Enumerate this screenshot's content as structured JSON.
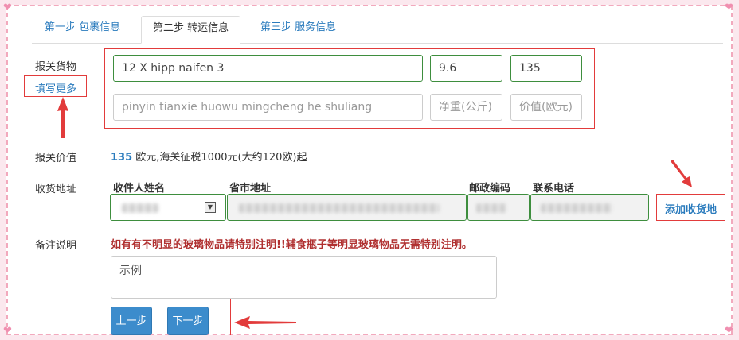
{
  "tabs": [
    {
      "label": "第一步 包裹信息"
    },
    {
      "label": "第二步 转运信息"
    },
    {
      "label": "第三步 服务信息"
    }
  ],
  "goods": {
    "label": "报关货物",
    "more_link": "填写更多",
    "row1": {
      "name": "12 X hipp naifen 3",
      "weight": "9.6",
      "value": "135"
    },
    "row2_placeholders": {
      "name": "pinyin tianxie huowu mingcheng he shuliang",
      "weight": "净重(公斤)",
      "value": "价值(欧元)"
    }
  },
  "declared": {
    "label": "报关价值",
    "amount": "135",
    "text": "欧元,海关征税1000元(大约120欧)起"
  },
  "address": {
    "label": "收货地址",
    "columns": [
      "收件人姓名",
      "省市地址",
      "邮政编码",
      "联系电话"
    ],
    "add_button": "添加收货地"
  },
  "remark": {
    "label": "备注说明",
    "warning": "如有有不明显的玻璃物品请特别注明!!辅食瓶子等明显玻璃物品无需特别注明。",
    "placeholder": "示例"
  },
  "buttons": {
    "prev": "上一步",
    "next": "下一步"
  },
  "colors": {
    "accent": "#2a7bbd",
    "warning": "#b03030",
    "annotation": "#e23b3b",
    "border_ok": "#3e8e3e"
  }
}
